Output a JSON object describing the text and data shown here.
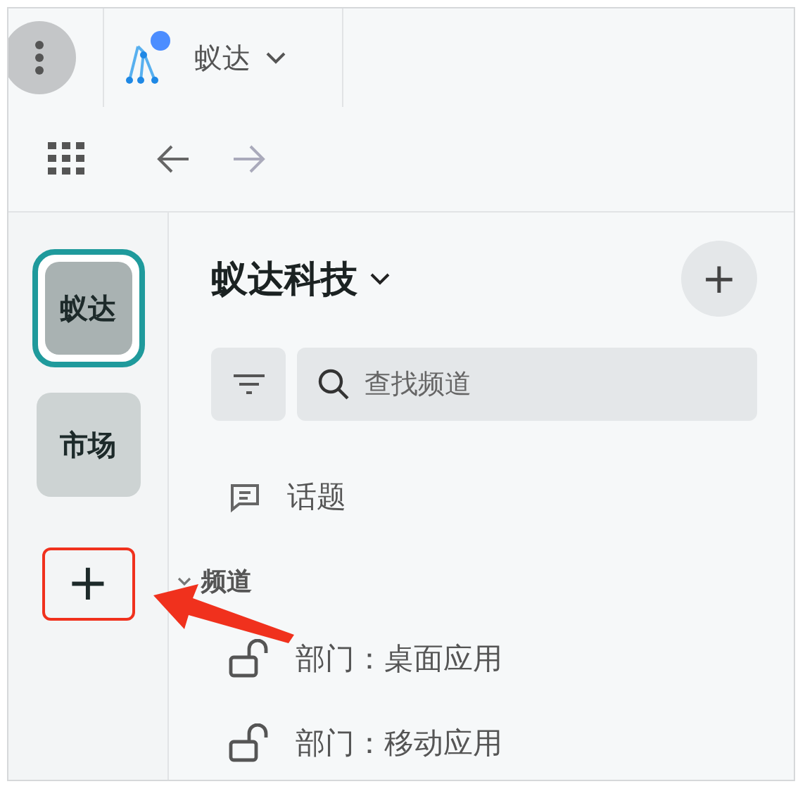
{
  "app_bar": {
    "app_name": "蚁达",
    "has_notification": true
  },
  "workspaces": [
    {
      "label": "蚁达",
      "selected": true
    },
    {
      "label": "市场",
      "selected": false
    }
  ],
  "add_workspace": {
    "label": "+",
    "highlighted": true
  },
  "org": {
    "name": "蚁达科技",
    "add_label": "+"
  },
  "search": {
    "placeholder": "查找频道"
  },
  "topics": {
    "label": "话题"
  },
  "channel_section": {
    "label": "频道",
    "expanded": true,
    "channels": [
      {
        "name": "部门：桌面应用"
      },
      {
        "name": "部门：移动应用"
      }
    ]
  }
}
